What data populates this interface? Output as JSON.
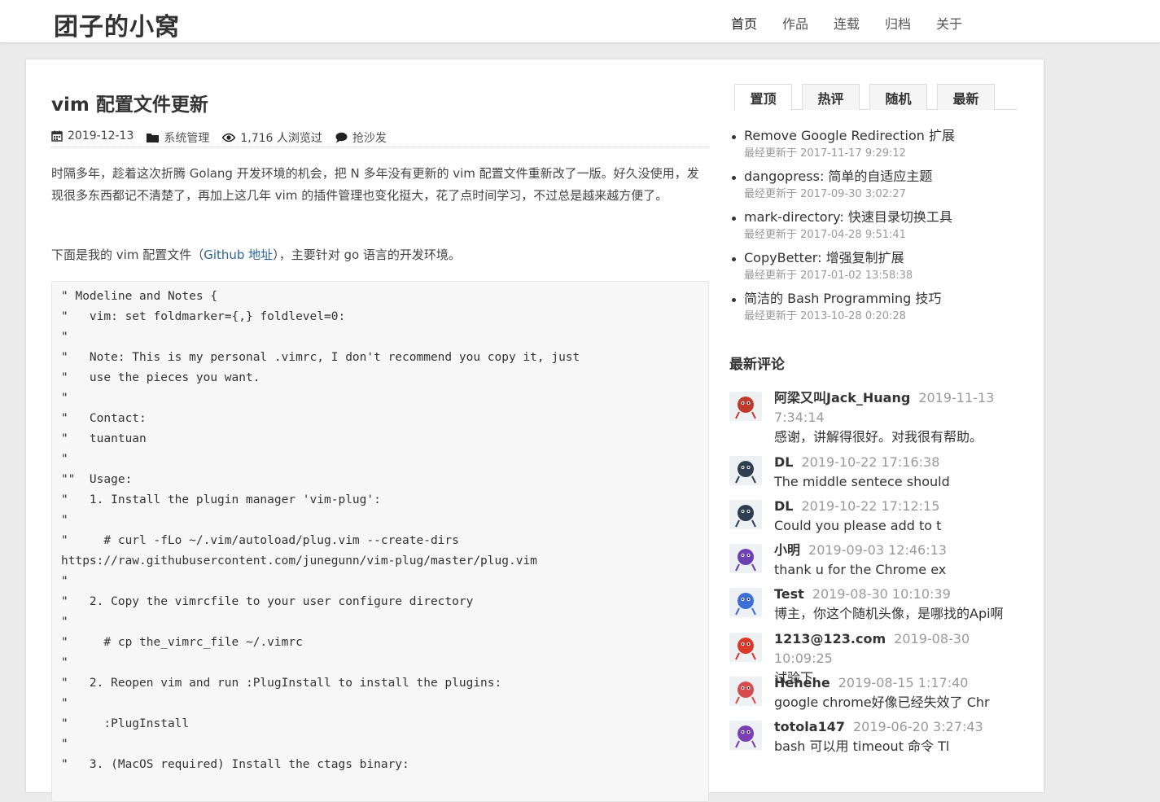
{
  "site": {
    "title": "团子的小窝"
  },
  "nav": [
    "首页",
    "作品",
    "连载",
    "归档",
    "关于"
  ],
  "post": {
    "title": "vim 配置文件更新",
    "date": "2019-12-13",
    "category": "系统管理",
    "views": "1,716 人浏览过",
    "comments": "抢沙发",
    "p1": "时隔多年，趁着这次折腾 Golang 开发环境的机会，把 N 多年没有更新的 vim 配置文件重新改了一版。好久没使用，发现很多东西都记不清楚了，再加上这几年 vim 的插件管理也变化挺大，花了点时间学习，不过总是越来越方便了。",
    "p2_before": "下面是我的 vim 配置文件（",
    "p2_link": "Github 地址",
    "p2_after": "），主要针对 go 语言的开发环境。",
    "code_lines": [
      "\" Modeline and Notes {",
      "\"   vim: set foldmarker={,} foldlevel=0:",
      "\"",
      "\"   Note: This is my personal .vimrc, I don't recommend you copy it, just",
      "\"   use the pieces you want.",
      "\"",
      "\"   Contact:",
      "\"   tuantuan",
      "\"",
      "\"\"  Usage:",
      "\"   1. Install the plugin manager 'vim-plug':",
      "\"",
      "\"     # curl -fLo ~/.vim/autoload/plug.vim --create-dirs",
      "https://raw.githubusercontent.com/junegunn/vim-plug/master/plug.vim",
      "\"",
      "\"   2. Copy the vimrcfile to your user configure directory",
      "\"",
      "\"     # cp the_vimrc_file ~/.vimrc",
      "\"",
      "\"   2. Reopen vim and run :PlugInstall to install the plugins:",
      "\"",
      "\"     :PlugInstall",
      "\"",
      "\"   3. (MacOS required) Install the ctags binary:"
    ]
  },
  "sidebar": {
    "tabs": [
      "置顶",
      "热评",
      "随机",
      "最新"
    ],
    "top_posts": [
      {
        "title": "Remove Google Redirection 扩展",
        "updated": "最经更新于 2017-11-17 9:29:12"
      },
      {
        "title": "dangopress: 简单的自适应主题",
        "updated": "最经更新于 2017-09-30 3:02:27"
      },
      {
        "title": "mark-directory: 快速目录切换工具",
        "updated": "最经更新于 2017-04-28 9:51:41"
      },
      {
        "title": "CopyBetter: 增强复制扩展",
        "updated": "最经更新于 2017-01-02 13:58:38"
      },
      {
        "title": "简洁的 Bash Programming 技巧",
        "updated": "最经更新于 2013-10-28 0:20:28"
      }
    ],
    "recent_comments_title": "最新评论",
    "comments": [
      {
        "author": "阿梁又叫Jack_Huang",
        "time": "2019-11-13 7:34:14",
        "text": "感谢，讲解得很好。对我很有帮助。",
        "color": "#c0392b"
      },
      {
        "author": "DL",
        "time": "2019-10-22 17:16:38",
        "text": "The middle sentece should",
        "color": "#2c3e50"
      },
      {
        "author": "DL",
        "time": "2019-10-22 17:12:15",
        "text": "Could you please add to t",
        "color": "#2c3e50"
      },
      {
        "author": "小明",
        "time": "2019-09-03 12:46:13",
        "text": "thank u for the Chrome ex",
        "color": "#6c3fb5"
      },
      {
        "author": "Test",
        "time": "2019-08-30 10:10:39",
        "text": "博主，你这个随机头像，是哪找的Api啊",
        "color": "#3b6fd6"
      },
      {
        "author": "1213@123.com",
        "time": "2019-08-30 10:09:25",
        "text": "试验下",
        "color": "#d9382b"
      },
      {
        "author": "Hehehe",
        "time": "2019-08-15 1:17:40",
        "text": "google chrome好像已经失效了 Chr",
        "color": "#d64c4c"
      },
      {
        "author": "totola147",
        "time": "2019-06-20 3:27:43",
        "text": "bash 可以用 timeout 命令 Tl",
        "color": "#7b3fb5"
      }
    ]
  }
}
